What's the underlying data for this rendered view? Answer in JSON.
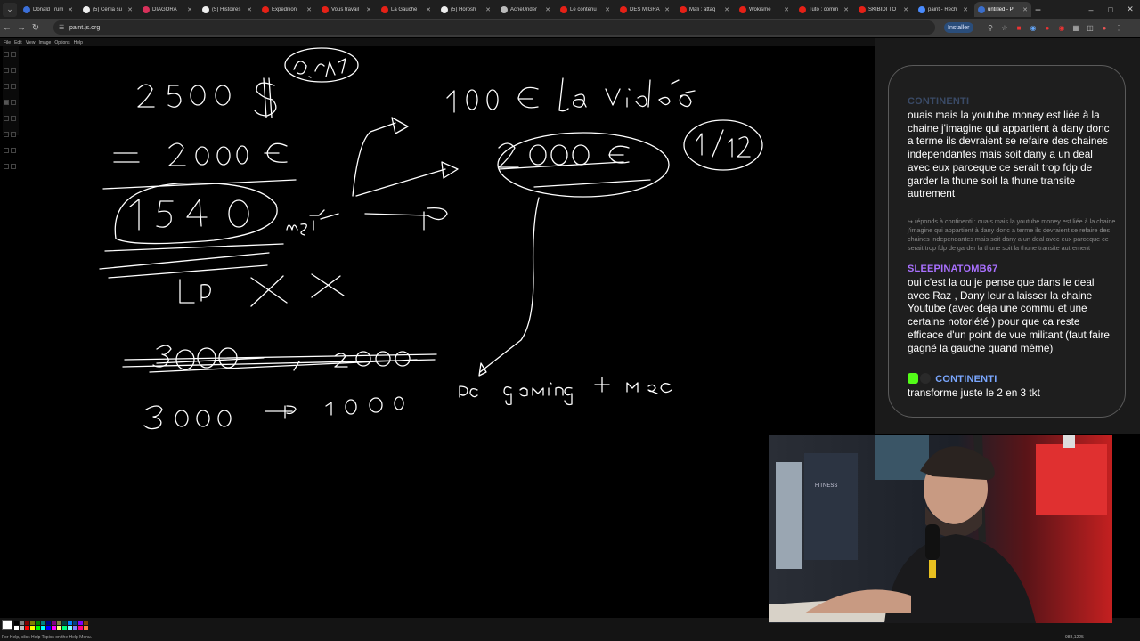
{
  "browser": {
    "tabs": [
      {
        "label": "Donald Trum",
        "fav": "#3b6fd8",
        "active": false
      },
      {
        "label": "(5) Cerfia su",
        "fav": "#eeeeee",
        "active": false
      },
      {
        "label": "DIAGORA",
        "fav": "#d8315b",
        "active": false
      },
      {
        "label": "(5) Histoires",
        "fav": "#eeeeee",
        "active": false
      },
      {
        "label": "Expedition",
        "fav": "#e62117",
        "active": false
      },
      {
        "label": "Vous travail",
        "fav": "#e62117",
        "active": false
      },
      {
        "label": "La Gauche",
        "fav": "#e62117",
        "active": false
      },
      {
        "label": "(5) Horosh",
        "fav": "#eeeeee",
        "active": false
      },
      {
        "label": "AcheUnder",
        "fav": "#bbbbbb",
        "active": false
      },
      {
        "label": "Le contenu",
        "fav": "#e62117",
        "active": false
      },
      {
        "label": "DES MIGRA",
        "fav": "#e62117",
        "active": false
      },
      {
        "label": "Mali : attaq",
        "fav": "#e62117",
        "active": false
      },
      {
        "label": "Wokisme",
        "fav": "#e62117",
        "active": false
      },
      {
        "label": "Tuto : comm",
        "fav": "#e62117",
        "active": false
      },
      {
        "label": "SKIBIDI TO",
        "fav": "#e62117",
        "active": false
      },
      {
        "label": "paint - Rech",
        "fav": "#4a8cff",
        "active": false
      },
      {
        "label": "untitled - P",
        "fav": "#3a6ecc",
        "active": true
      }
    ],
    "new_tab": "+",
    "url": "paint.js.org",
    "install_label": "Installer",
    "window_controls": [
      "–",
      "□",
      "✕"
    ]
  },
  "paint": {
    "menus": [
      "File",
      "Edit",
      "View",
      "Image",
      "Options",
      "Help"
    ],
    "status_help": "For Help, click Help Topics on the Help Menu.",
    "status_coords": "988,1225",
    "palette": [
      "#000000",
      "#808080",
      "#800000",
      "#808000",
      "#008000",
      "#008080",
      "#000080",
      "#800080",
      "#808040",
      "#004040",
      "#0080ff",
      "#004080",
      "#8000ff",
      "#804000",
      "#ffffff",
      "#c0c0c0",
      "#ff0000",
      "#ffff00",
      "#00ff00",
      "#00ffff",
      "#0000ff",
      "#ff00ff",
      "#ffff80",
      "#00ff80",
      "#80ffff",
      "#8080ff",
      "#ff0080",
      "#ff8040"
    ]
  },
  "chat": {
    "ghost_user": "CONTINENTI",
    "msg1_text": "ouais mais la youtube money est liée à la chaine j'imagine qui appartient à dany donc a terme ils devraient se refaire des chaines independantes mais soit dany a un deal avec eux parceque ce serait trop fdp de garder la thune soit la thune transite autrement",
    "reply_text": "↪ réponds à continenti : ouais mais la youtube money est liée à la chaine j'imagine qui appartient à dany donc a terme ils devraient se refaire des chaines independantes mais soit dany a un deal avec eux parceque ce serait trop fdp de garder la thune soit la thune transite autrement",
    "msg2_user": "SLEEPINATOMB67",
    "msg2_text": "oui c'est la ou je pense que dans le deal avec Raz , Dany leur a laisser la chaine Youtube (avec deja une commu et une certaine notoriété ) pour que ca reste efficace d'un point de vue militant (faut faire gagné la gauche quand même)",
    "msg3_user": "CONTINENTI",
    "msg3_text": "transforme juste le 2 en 3 tkt",
    "colors": {
      "user_purple": "#a970ff",
      "user_blue": "#7aa7ff",
      "ghost": "#3a4a66",
      "kick_green": "#53fc18"
    }
  }
}
